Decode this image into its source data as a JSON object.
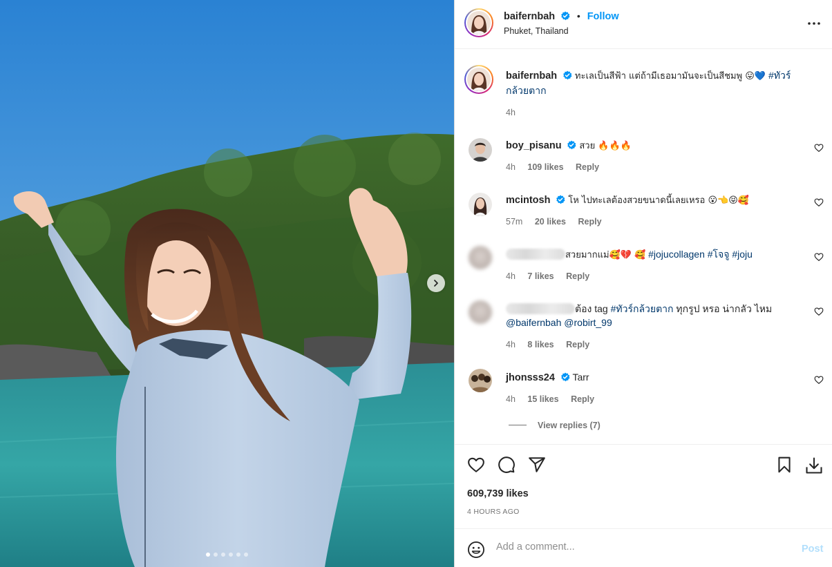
{
  "post": {
    "username": "baifernbah",
    "follow_label": "Follow",
    "separator": "•",
    "location": "Phuket, Thailand",
    "caption": {
      "username": "baifernbah",
      "text": "ทะเลเป็นสีฟ้า แต่ถ้ามีเธอมามันจะเป็นสีชมพู 😛💙",
      "hashtag_line1": "#ทัวร์",
      "hashtag_line2": "กล้วยตาก",
      "time": "4h"
    },
    "carousel": {
      "slides": 6,
      "active": 0
    }
  },
  "comments": [
    {
      "username": "boy_pisanu",
      "verified": true,
      "text": "สวย 🔥🔥🔥",
      "time": "4h",
      "likes": "109 likes",
      "reply": "Reply"
    },
    {
      "username": "mcintosh",
      "verified": true,
      "text": "โห ไปทะเลต้องสวยขนาดนี้เลยเหรอ 😮👈😝🥰",
      "time": "57m",
      "likes": "20 likes",
      "reply": "Reply"
    },
    {
      "username": "",
      "verified": false,
      "text": "สวยมากแม่🥰💔 🥰",
      "tags": "#jojucollagen #โจจู #joju",
      "time": "4h",
      "likes": "7 likes",
      "reply": "Reply"
    },
    {
      "username": "",
      "verified": false,
      "text": "ต้อง tag",
      "tag1": "#ทัวร์กล้วยตาก",
      "text2": "ทุกรูป หรอ น่ากลัว ไหม",
      "mention1": "@baifernbah",
      "mention2": "@robirt_99",
      "time": "4h",
      "likes": "8 likes",
      "reply": "Reply"
    },
    {
      "username": "jhonsss24",
      "verified": true,
      "text": "Tarr",
      "time": "4h",
      "likes": "15 likes",
      "reply": "Reply"
    }
  ],
  "view_replies": "View replies (7)",
  "stats": {
    "likes": "609,739 likes",
    "posted": "4 HOURS AGO"
  },
  "composer": {
    "placeholder": "Add a comment...",
    "post_label": "Post"
  },
  "colors": {
    "accent": "#0095f6",
    "verified": "#0095f6",
    "hashtag": "#00376b",
    "muted": "#737373"
  },
  "icons": [
    "verified-badge-icon",
    "more-options-icon",
    "heart-icon",
    "comment-icon",
    "share-icon",
    "save-icon",
    "download-icon",
    "emoji-icon",
    "chevron-right-icon"
  ]
}
